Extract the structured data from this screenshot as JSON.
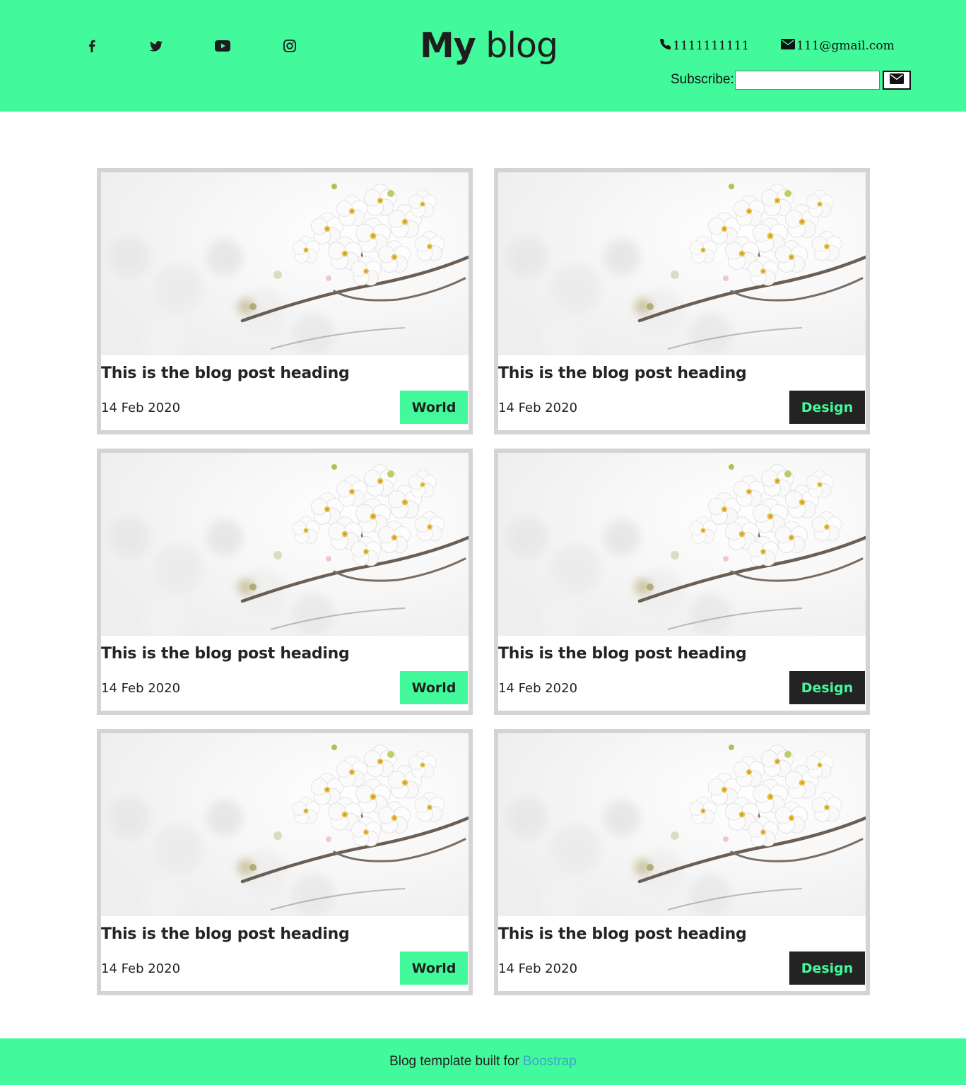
{
  "header": {
    "brand_bold": "My",
    "brand_light": "blog",
    "phone": "1111111111",
    "email": "111@gmail.com",
    "subscribe_label": "Subscribe:",
    "subscribe_placeholder": "",
    "social_icons": [
      "facebook-icon",
      "twitter-icon",
      "youtube-icon",
      "instagram-icon"
    ]
  },
  "posts": [
    {
      "heading": "This is the blog post heading",
      "date": "14 Feb 2020",
      "tag": "World"
    },
    {
      "heading": "This is the blog post heading",
      "date": "14 Feb 2020",
      "tag": "Design"
    },
    {
      "heading": "This is the blog post heading",
      "date": "14 Feb 2020",
      "tag": "World"
    },
    {
      "heading": "This is the blog post heading",
      "date": "14 Feb 2020",
      "tag": "Design"
    },
    {
      "heading": "This is the blog post heading",
      "date": "14 Feb 2020",
      "tag": "World"
    },
    {
      "heading": "This is the blog post heading",
      "date": "14 Feb 2020",
      "tag": "Design"
    }
  ],
  "footer": {
    "text": "Blog template built for",
    "link": "Boostrap"
  },
  "colors": {
    "accent": "#42fa9b",
    "dark": "#232323",
    "card_border": "#d4d4d4",
    "link": "#3aa8c6"
  }
}
